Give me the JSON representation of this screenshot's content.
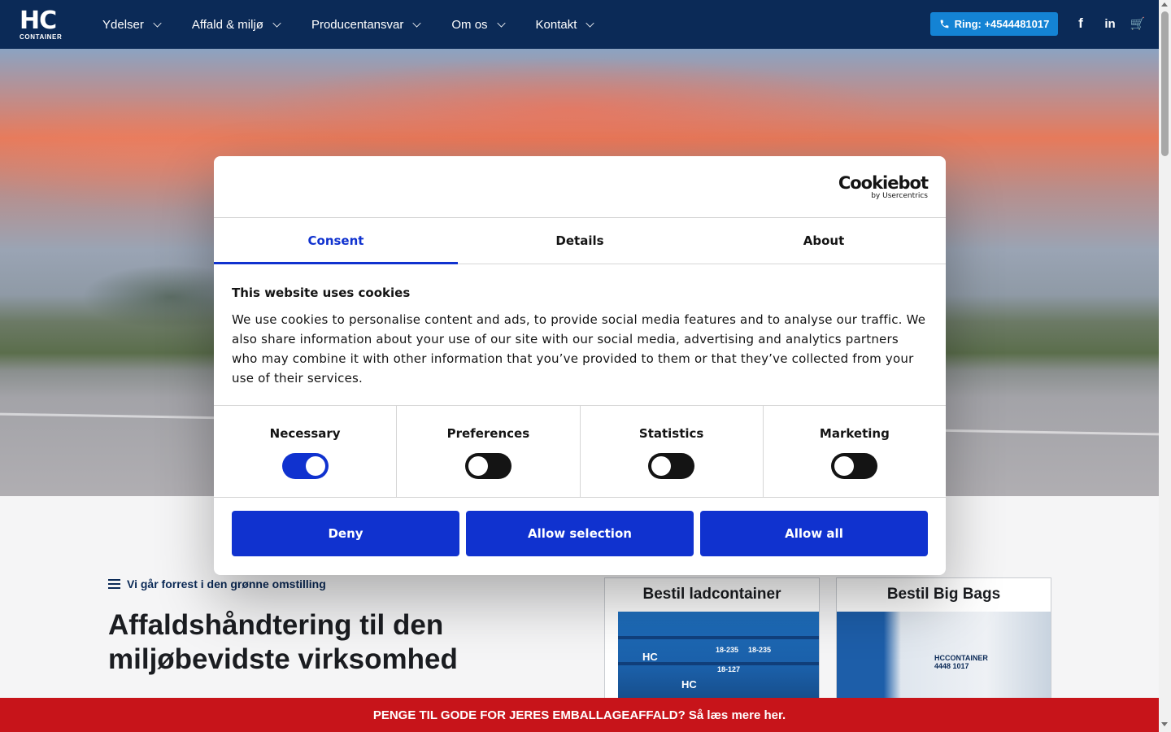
{
  "nav": {
    "logo_mark": "HC",
    "logo_sub": "CONTAINER",
    "menu": [
      {
        "label": "Ydelser"
      },
      {
        "label": "Affald & miljø"
      },
      {
        "label": "Producentansvar"
      },
      {
        "label": "Om os"
      },
      {
        "label": "Kontakt"
      }
    ],
    "call_label": "Ring: +4544481017",
    "facebook_glyph": "f",
    "linkedin_glyph": "in",
    "cart_glyph": "🛒"
  },
  "content": {
    "tagline": "Vi går forrest i den grønne omstilling",
    "headline": "Affaldshåndtering til den miljøbevidste virksomhed",
    "cards": [
      {
        "title": "Bestil ladcontainer"
      },
      {
        "title": "Bestil Big Bags"
      }
    ],
    "card_tags": [
      "HC",
      "18-235",
      "18-235",
      "18-127",
      "HC"
    ],
    "bag_text": "HCCONTAINER",
    "bag_number": "4448 1017"
  },
  "promo": "PENGE TIL GODE FOR JERES EMBALLAGEAFFALD? Så læs mere her.",
  "cookie": {
    "brand": "Cookiebot",
    "brand_sub": "by Usercentrics",
    "tabs": [
      "Consent",
      "Details",
      "About"
    ],
    "active_tab": "Consent",
    "title": "This website uses cookies",
    "body": "We use cookies to personalise content and ads, to provide social media features and to analyse our traffic. We also share information about your use of our site with our social media, advertising and analytics partners who may combine it with other information that you’ve provided to them or that they’ve collected from your use of their services.",
    "toggles": [
      {
        "label": "Necessary",
        "on": true
      },
      {
        "label": "Preferences",
        "on": false
      },
      {
        "label": "Statistics",
        "on": false
      },
      {
        "label": "Marketing",
        "on": false
      }
    ],
    "buttons": [
      "Deny",
      "Allow selection",
      "Allow all"
    ]
  },
  "colors": {
    "nav_bg": "#0b2a57",
    "accent_blue": "#1032cf",
    "call_blue": "#1483d4",
    "promo_red": "#c7141a"
  }
}
